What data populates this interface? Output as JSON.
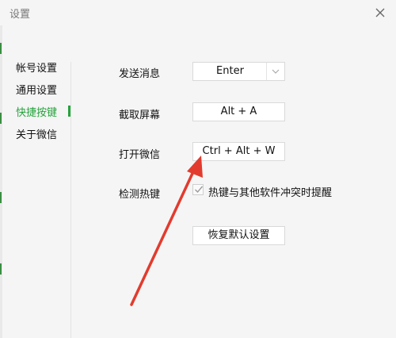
{
  "window": {
    "title": "设置",
    "close_icon": "close-icon"
  },
  "sidebar": {
    "items": [
      {
        "label": "帐号设置",
        "active": false
      },
      {
        "label": "通用设置",
        "active": false
      },
      {
        "label": "快捷按键",
        "active": true
      },
      {
        "label": "关于微信",
        "active": false
      }
    ]
  },
  "shortcuts": {
    "send_message": {
      "label": "发送消息",
      "value": "Enter",
      "dropdown_icon": "chevron-down-icon"
    },
    "screenshot": {
      "label": "截取屏幕",
      "value": "Alt + A"
    },
    "open_wechat": {
      "label": "打开微信",
      "value": "Ctrl + Alt + W"
    },
    "detect_hotkey": {
      "label": "检测热键",
      "checkbox_label": "热键与其他软件冲突时提醒",
      "checked": true
    },
    "reset_button": "恢复默认设置"
  },
  "colors": {
    "accent": "#24a33b",
    "annotation_arrow": "#e23b2e"
  }
}
